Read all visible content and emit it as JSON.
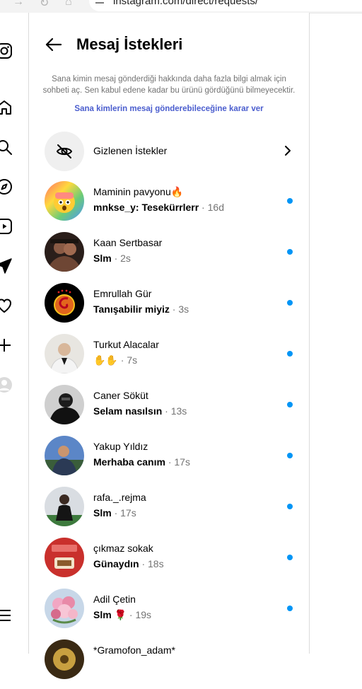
{
  "browser": {
    "url": "instagram.com/direct/requests/"
  },
  "header": {
    "title": "Mesaj İstekleri"
  },
  "info_text": "Sana kimin mesaj gönderdiği hakkında daha fazla bilgi almak için sohbeti aç. Sen kabul edene kadar bu ürünü gördüğünü bilmeyecektir.",
  "manage_link": "Sana kimlerin mesaj gönderebileceğine karar ver",
  "hidden_requests": {
    "label": "Gizlenen İstekler"
  },
  "accent_colors": {
    "unread": "#0095f6",
    "link": "#4a5dce",
    "meta": "#737373"
  },
  "requests": [
    {
      "name": "Maminin pavyonu🔥",
      "message": "mnkse_y: Tesekürrlerr",
      "time": "16d",
      "unread": true
    },
    {
      "name": "Kaan Sertbasar",
      "message": "Slm",
      "time": "2s",
      "unread": true
    },
    {
      "name": "Emrullah Gür",
      "message": "Tanışabilir miyiz",
      "time": "3s",
      "unread": true
    },
    {
      "name": "Turkut Alacalar",
      "message": "✋✋",
      "time": "7s",
      "unread": true
    },
    {
      "name": "Caner Söküt",
      "message": "Selam nasılsın",
      "time": "13s",
      "unread": true
    },
    {
      "name": "Yakup Yıldız",
      "message": "Merhaba canım",
      "time": "17s",
      "unread": true
    },
    {
      "name": "rafa._.rejma",
      "message": "Slm",
      "time": "17s",
      "unread": true
    },
    {
      "name": "çıkmaz sokak",
      "message": "Günaydın",
      "time": "18s",
      "unread": true
    },
    {
      "name": "Adil Çetin",
      "message": "Slm 🌹",
      "time": "19s",
      "unread": true
    },
    {
      "name": "*Gramofon_adam*",
      "message": "",
      "time": "",
      "unread": false
    }
  ]
}
